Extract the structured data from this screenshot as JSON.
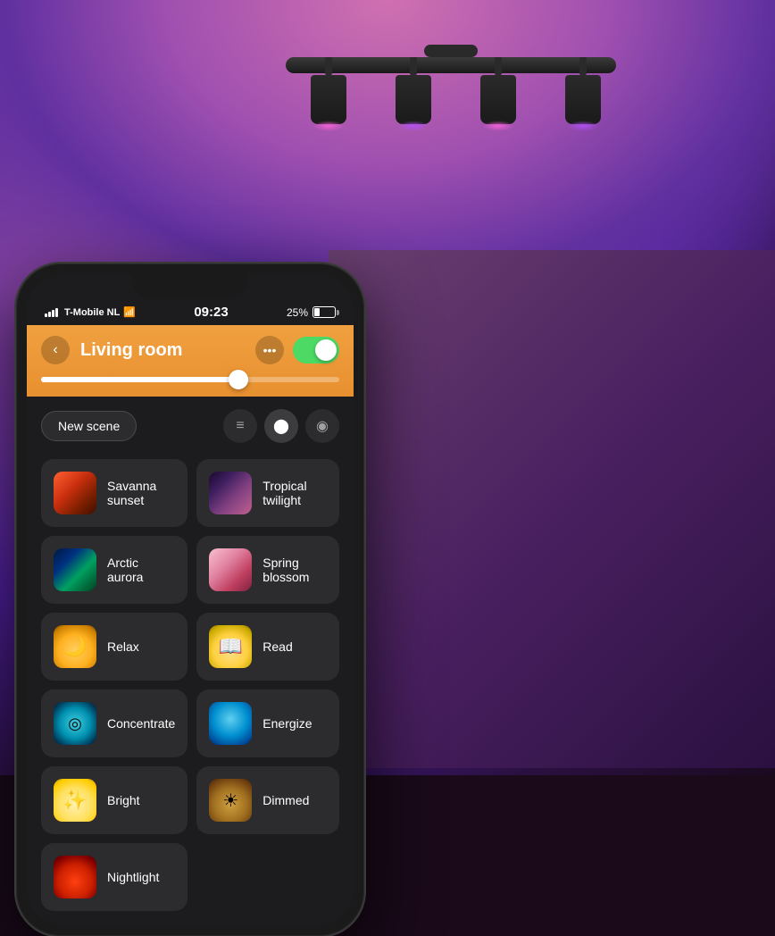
{
  "status_bar": {
    "carrier": "T-Mobile NL",
    "time": "09:23",
    "battery_percent": "25%"
  },
  "header": {
    "back_label": "‹",
    "title": "Living room",
    "more_dots": "•••",
    "toggle_on": true
  },
  "scene_controls": {
    "new_scene_label": "New scene",
    "view_list_icon": "≡",
    "view_grid_icon": "●",
    "view_color_icon": "◉"
  },
  "scenes": [
    {
      "id": "savanna-sunset",
      "label": "Savanna sunset",
      "thumb": "savanna"
    },
    {
      "id": "tropical-twilight",
      "label": "Tropical twilight",
      "thumb": "tropical"
    },
    {
      "id": "arctic-aurora",
      "label": "Arctic aurora",
      "thumb": "arctic"
    },
    {
      "id": "spring-blossom",
      "label": "Spring blossom",
      "thumb": "spring"
    },
    {
      "id": "relax",
      "label": "Relax",
      "thumb": "relax"
    },
    {
      "id": "read",
      "label": "Read",
      "thumb": "read"
    },
    {
      "id": "concentrate",
      "label": "Concentrate",
      "thumb": "concentrate"
    },
    {
      "id": "energize",
      "label": "Energize",
      "thumb": "energize"
    },
    {
      "id": "bright",
      "label": "Bright",
      "thumb": "bright"
    },
    {
      "id": "dimmed",
      "label": "Dimmed",
      "thumb": "dimmed"
    },
    {
      "id": "nightlight",
      "label": "Nightlight",
      "thumb": "nightlight"
    }
  ],
  "colors": {
    "header_gradient_start": "#f0a040",
    "header_gradient_end": "#e89030",
    "screen_bg": "#1c1c1e",
    "card_bg": "#2c2c2e"
  }
}
